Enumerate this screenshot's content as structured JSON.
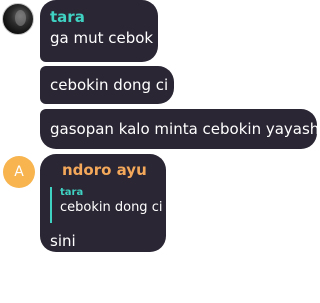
{
  "messages": [
    {
      "sender": "tara",
      "avatar": "photo",
      "texts": [
        "ga mut cebok",
        "cebokin dong ci",
        "gasopan kalo minta cebokin yayash"
      ]
    },
    {
      "sender": "ndoro ayu",
      "avatar_letter": "A",
      "reply_to": {
        "sender": "tara",
        "text": "cebokin dong ci"
      },
      "text": "sini"
    }
  ],
  "colors": {
    "bubble": "#2b2634",
    "tara_name": "#3fd1c2",
    "ndoro_name": "#f4a85a",
    "ndoro_avatar": "#f7b44f"
  }
}
